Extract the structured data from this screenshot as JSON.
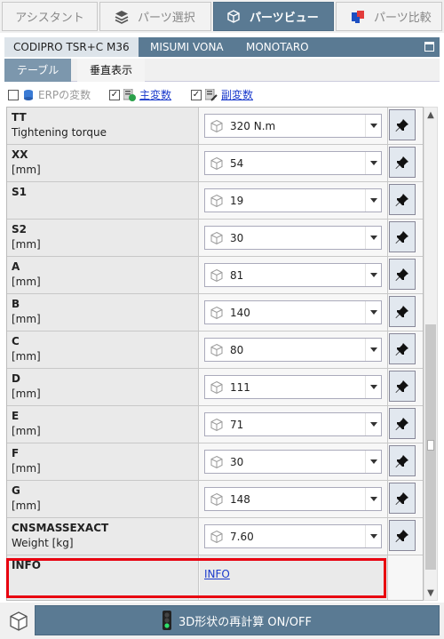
{
  "top_tabs": [
    {
      "label": "アシスタント",
      "active": false
    },
    {
      "label": "パーツ選択",
      "active": false,
      "icon": "layers-icon"
    },
    {
      "label": "パーツビュー",
      "active": true,
      "icon": "cube-view-icon"
    },
    {
      "label": "パーツ比較",
      "active": false,
      "icon": "compare-icon"
    }
  ],
  "sources": [
    {
      "label": "CODIPRO TSR+C M36",
      "active": true
    },
    {
      "label": "MISUMI VONA",
      "active": false
    },
    {
      "label": "MONOTARO",
      "active": false
    }
  ],
  "view_tabs": [
    {
      "label": "テーブル",
      "active": false
    },
    {
      "label": "垂直表示",
      "active": true
    }
  ],
  "filters": {
    "erp": {
      "label": "ERPの変数",
      "checked": false
    },
    "main": {
      "label": "主変数",
      "checked": true
    },
    "sub": {
      "label": "副変数",
      "checked": true
    }
  },
  "rows": [
    {
      "name": "TT",
      "desc": "Tightening torque",
      "value": "320 N.m"
    },
    {
      "name": "XX",
      "desc": "[mm]",
      "value": "54"
    },
    {
      "name": "S1",
      "desc": "",
      "value": "19"
    },
    {
      "name": "S2",
      "desc": "[mm]",
      "value": "30"
    },
    {
      "name": "A",
      "desc": "[mm]",
      "value": "81"
    },
    {
      "name": "B",
      "desc": "[mm]",
      "value": "140"
    },
    {
      "name": "C",
      "desc": "[mm]",
      "value": "80"
    },
    {
      "name": "D",
      "desc": "[mm]",
      "value": "111"
    },
    {
      "name": "E",
      "desc": "[mm]",
      "value": "71"
    },
    {
      "name": "F",
      "desc": "[mm]",
      "value": "30"
    },
    {
      "name": "G",
      "desc": "[mm]",
      "value": "148"
    },
    {
      "name": "CNSMASSEXACT",
      "desc": "Weight [kg]",
      "value": "7.60"
    }
  ],
  "info_row": {
    "name": "INFO",
    "link": "INFO"
  },
  "recalc_label": "3D形状の再計算 ON/OFF",
  "colors": {
    "accent": "#5a7a93",
    "highlight": "#e8000f",
    "link": "#1a3acc"
  }
}
